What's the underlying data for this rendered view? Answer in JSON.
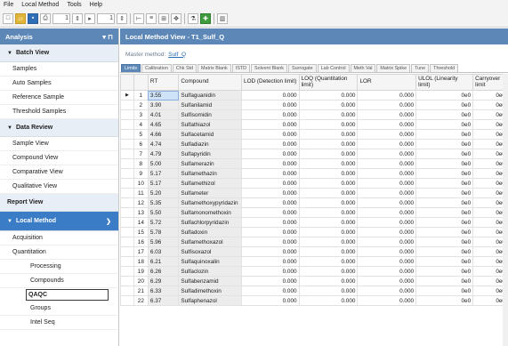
{
  "menu": {
    "file": "File",
    "local_method": "Local Method",
    "tools": "Tools",
    "help": "Help"
  },
  "toolbar": {
    "spin1": "1",
    "spin2": "1"
  },
  "sidebar": {
    "header": "Analysis",
    "batch_view": "Batch View",
    "batch_items": [
      "Samples",
      "Auto Samples",
      "Reference Sample",
      "Threshold Samples"
    ],
    "data_review": "Data Review",
    "data_items": [
      "Sample View",
      "Compound View",
      "Comparative View",
      "Qualitative View"
    ],
    "report_view": "Report View",
    "local_method": "Local Method",
    "acquisition": "Acquisition",
    "quantitation": "Quantitation",
    "processing": "Processing",
    "compounds": "Compounds",
    "qaqc": "QAQC",
    "groups": "Groups",
    "intel_seq": "Intel Seq"
  },
  "main": {
    "title": "Local Method View - T1_Sulf_Q",
    "master_label": "Master method:",
    "master_link": "Sulf_Q",
    "tabs": [
      "Limits",
      "Calibration",
      "Chk Std",
      "Matrix Blank",
      "ISTD",
      "Solvent Blank",
      "Surrogate",
      "Lab Control",
      "Meth Val",
      "Matrix Spike",
      "Tune",
      "Threshold"
    ],
    "columns": [
      "",
      "RT",
      "Compound",
      "LOD (Detection limit)",
      "LOQ (Quantitation limit)",
      "LOR",
      "ULOL (Linearity limit)",
      "Carryover limit"
    ],
    "rows": [
      {
        "n": "1",
        "rt": "3.55",
        "c": "Sulfaguanidin"
      },
      {
        "n": "2",
        "rt": "3.90",
        "c": "Sulfanilamid"
      },
      {
        "n": "3",
        "rt": "4.01",
        "c": "Sulfisomidin"
      },
      {
        "n": "4",
        "rt": "4.65",
        "c": "Sulfathiazol"
      },
      {
        "n": "5",
        "rt": "4.66",
        "c": "Sulfacetamid"
      },
      {
        "n": "6",
        "rt": "4.74",
        "c": "Sulfadiazin"
      },
      {
        "n": "7",
        "rt": "4.79",
        "c": "Sulfapyridin"
      },
      {
        "n": "8",
        "rt": "5.00",
        "c": "Sulfamerazin"
      },
      {
        "n": "9",
        "rt": "5.17",
        "c": "Sulfamethazin"
      },
      {
        "n": "10",
        "rt": "5.17",
        "c": "Sulfamethizol"
      },
      {
        "n": "11",
        "rt": "5.20",
        "c": "Sulfameter"
      },
      {
        "n": "12",
        "rt": "5.35",
        "c": "Sulfamethoxypyridazin"
      },
      {
        "n": "13",
        "rt": "5.50",
        "c": "Sulfamonomethoxin"
      },
      {
        "n": "14",
        "rt": "5.72",
        "c": "Sulfachlorpyridazin"
      },
      {
        "n": "15",
        "rt": "5.78",
        "c": "Sulfadoxin"
      },
      {
        "n": "16",
        "rt": "5.96",
        "c": "Sulfamethoxazol"
      },
      {
        "n": "17",
        "rt": "6.03",
        "c": "Sulfisoxazol"
      },
      {
        "n": "18",
        "rt": "6.21",
        "c": "Sulfaquinoxalin"
      },
      {
        "n": "19",
        "rt": "6.26",
        "c": "Sulfaclozin"
      },
      {
        "n": "20",
        "rt": "6.29",
        "c": "Sulfabenzamid"
      },
      {
        "n": "21",
        "rt": "6.33",
        "c": "Sulfadimethoxin"
      },
      {
        "n": "22",
        "rt": "6.37",
        "c": "Sulfaphenazol"
      }
    ],
    "lod": "0.000",
    "loq": "0.000",
    "lor": "0.000",
    "ulol": "0e0",
    "carry": "0e0"
  }
}
